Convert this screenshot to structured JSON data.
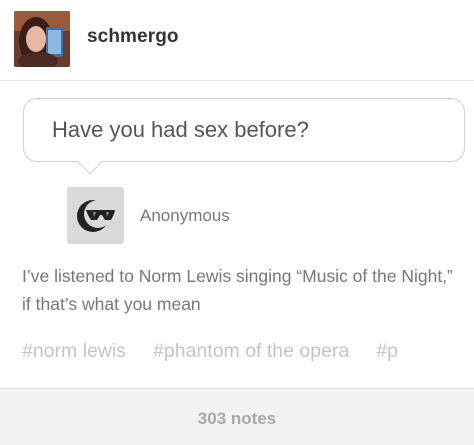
{
  "post": {
    "username": "schmergo",
    "question": "Have you had sex before?",
    "asker": "Anonymous",
    "answer": "I’ve listened to Norm Lewis singing “Music of the Night,” if that’s what you mean",
    "tags": [
      "#norm lewis",
      "#phantom of the opera",
      "#p"
    ],
    "notes": "303 notes"
  },
  "icons": {
    "avatar": "user-photo",
    "asker_avatar": "anonymous-sunglasses-icon"
  },
  "colors": {
    "background": "#ffffff",
    "footer_background": "#f2f2f2",
    "tag_text": "#c4c4c4",
    "notes_text": "#a8a8a8"
  }
}
